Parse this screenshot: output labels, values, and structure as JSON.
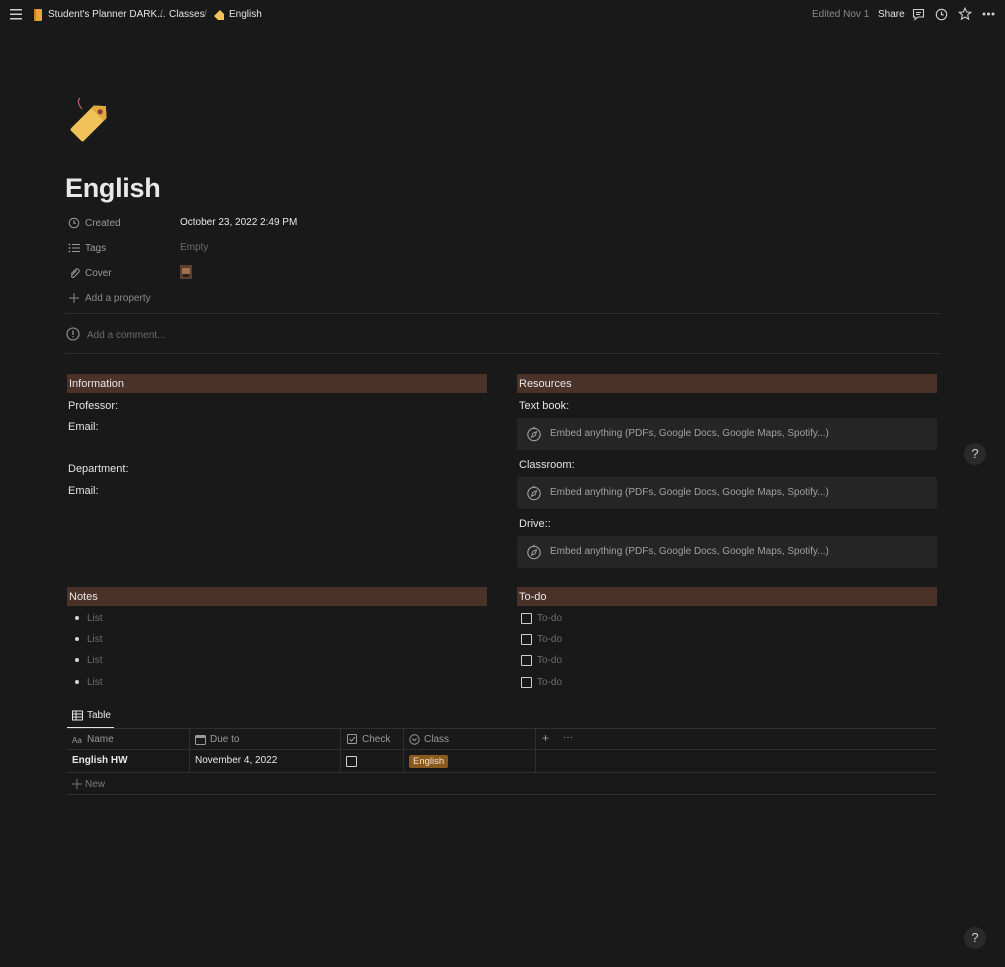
{
  "topbar": {
    "breadcrumb": [
      {
        "label": "Student's Planner DARK..."
      },
      {
        "label": "Classes"
      },
      {
        "label": "English"
      }
    ],
    "separator": "/",
    "edited": "Edited Nov 1",
    "share_label": "Share"
  },
  "page": {
    "icon": "tag-icon",
    "title": "English",
    "properties": [
      {
        "icon": "clock-icon",
        "label": "Created",
        "value": "October 23, 2022 2:49 PM"
      },
      {
        "icon": "list-icon",
        "label": "Tags",
        "value": "Empty"
      },
      {
        "icon": "paperclip-icon",
        "label": "Cover",
        "value": ""
      }
    ],
    "add_property": "Add a property",
    "comment_placeholder": "Add a comment..."
  },
  "information": {
    "heading": "Information",
    "lines": [
      "Professor:",
      "Email:",
      "Department:",
      "Email:"
    ]
  },
  "resources": {
    "heading": "Resources",
    "items": [
      {
        "label": "Text book:",
        "embed": "Embed anything (PDFs, Google Docs, Google Maps, Spotify...)"
      },
      {
        "label": "Classroom:",
        "embed": "Embed anything (PDFs, Google Docs, Google Maps, Spotify...)"
      },
      {
        "label": "Drive::",
        "embed": "Embed anything (PDFs, Google Docs, Google Maps, Spotify...)"
      }
    ]
  },
  "notes": {
    "heading": "Notes",
    "items": [
      "List",
      "List",
      "List",
      "List"
    ]
  },
  "todo": {
    "heading": "To-do",
    "items": [
      "To-do",
      "To-do",
      "To-do",
      "To-do"
    ]
  },
  "table": {
    "tab_label": "Table",
    "columns": [
      {
        "icon": "text-icon",
        "label": "Name"
      },
      {
        "icon": "calendar-icon",
        "label": "Due to"
      },
      {
        "icon": "checkbox-icon",
        "label": "Check"
      },
      {
        "icon": "select-icon",
        "label": "Class"
      }
    ],
    "add_column": "+",
    "more": "···",
    "rows": [
      {
        "name": "English HW",
        "due": "November 4, 2022",
        "check": false,
        "class": "English"
      }
    ],
    "new_label": "New"
  },
  "help_label": "?",
  "colors": {
    "background": "#191919",
    "section_header": "#4a3228",
    "tag": "#8a5a1c"
  }
}
